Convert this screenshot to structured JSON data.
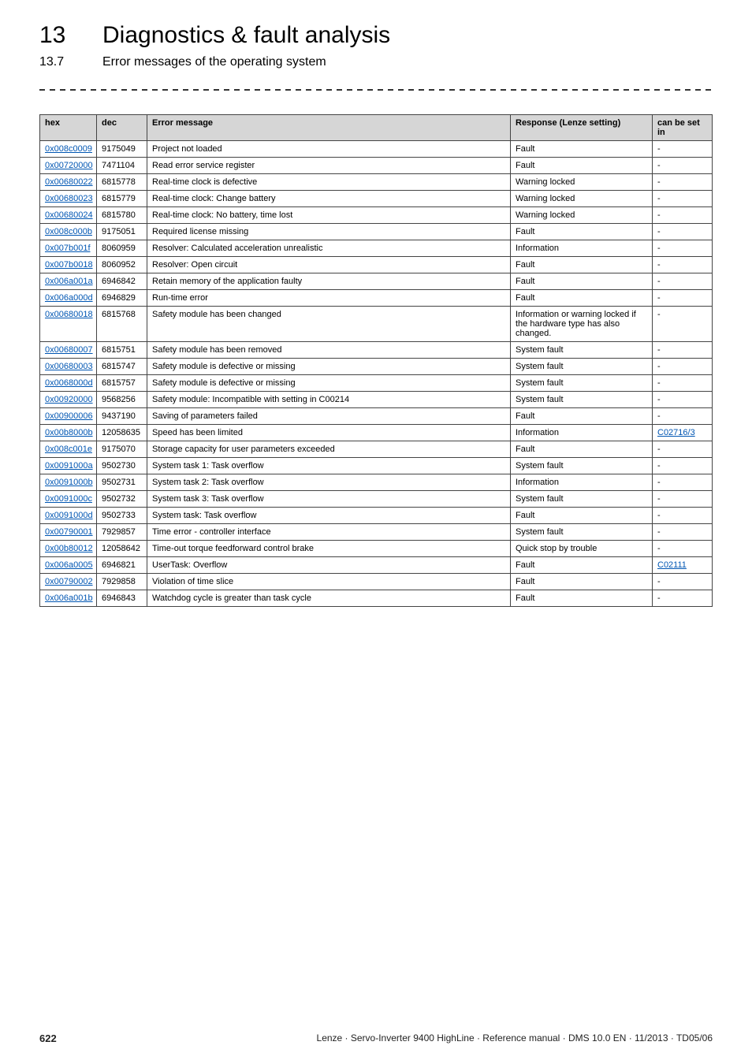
{
  "header": {
    "section_number": "13",
    "section_title": "Diagnostics & fault analysis",
    "subsection_number": "13.7",
    "subsection_title": "Error messages of the operating system"
  },
  "table": {
    "columns": {
      "hex": "hex",
      "dec": "dec",
      "msg": "Error message",
      "resp": "Response (Lenze setting)",
      "set": "can be set in"
    },
    "rows": [
      {
        "hex": "0x008c0009",
        "dec": "9175049",
        "msg": "Project not loaded",
        "resp": "Fault",
        "set": "-",
        "set_link": false
      },
      {
        "hex": "0x00720000",
        "dec": "7471104",
        "msg": "Read error service register",
        "resp": "Fault",
        "set": "-",
        "set_link": false
      },
      {
        "hex": "0x00680022",
        "dec": "6815778",
        "msg": "Real-time clock is defective",
        "resp": "Warning locked",
        "set": "-",
        "set_link": false
      },
      {
        "hex": "0x00680023",
        "dec": "6815779",
        "msg": "Real-time clock: Change battery",
        "resp": "Warning locked",
        "set": "-",
        "set_link": false
      },
      {
        "hex": "0x00680024",
        "dec": "6815780",
        "msg": "Real-time clock: No battery, time lost",
        "resp": "Warning locked",
        "set": "-",
        "set_link": false
      },
      {
        "hex": "0x008c000b",
        "dec": "9175051",
        "msg": "Required license missing",
        "resp": "Fault",
        "set": "-",
        "set_link": false
      },
      {
        "hex": "0x007b001f",
        "dec": "8060959",
        "msg": "Resolver: Calculated acceleration unrealistic",
        "resp": "Information",
        "set": "-",
        "set_link": false
      },
      {
        "hex": "0x007b0018",
        "dec": "8060952",
        "msg": "Resolver: Open circuit",
        "resp": "Fault",
        "set": "-",
        "set_link": false
      },
      {
        "hex": "0x006a001a",
        "dec": "6946842",
        "msg": "Retain memory of the application faulty",
        "resp": "Fault",
        "set": "-",
        "set_link": false
      },
      {
        "hex": "0x006a000d",
        "dec": "6946829",
        "msg": "Run-time error",
        "resp": "Fault",
        "set": "-",
        "set_link": false
      },
      {
        "hex": "0x00680018",
        "dec": "6815768",
        "msg": "Safety module has been changed",
        "resp": "Information or warning locked if the hardware type has also changed.",
        "set": "-",
        "set_link": false
      },
      {
        "hex": "0x00680007",
        "dec": "6815751",
        "msg": "Safety module has been removed",
        "resp": "System fault",
        "set": "-",
        "set_link": false
      },
      {
        "hex": "0x00680003",
        "dec": "6815747",
        "msg": "Safety module is defective or missing",
        "resp": "System fault",
        "set": "-",
        "set_link": false
      },
      {
        "hex": "0x0068000d",
        "dec": "6815757",
        "msg": "Safety module is defective or missing",
        "resp": "System fault",
        "set": "-",
        "set_link": false
      },
      {
        "hex": "0x00920000",
        "dec": "9568256",
        "msg": "Safety module: Incompatible with setting in C00214",
        "resp": "System fault",
        "set": "-",
        "set_link": false
      },
      {
        "hex": "0x00900006",
        "dec": "9437190",
        "msg": "Saving of parameters failed",
        "resp": "Fault",
        "set": "-",
        "set_link": false
      },
      {
        "hex": "0x00b8000b",
        "dec": "12058635",
        "msg": "Speed has been limited",
        "resp": "Information",
        "set": "C02716/3",
        "set_link": true
      },
      {
        "hex": "0x008c001e",
        "dec": "9175070",
        "msg": "Storage capacity for user parameters exceeded",
        "resp": "Fault",
        "set": "-",
        "set_link": false
      },
      {
        "hex": "0x0091000a",
        "dec": "9502730",
        "msg": "System task 1: Task overflow",
        "resp": "System fault",
        "set": "-",
        "set_link": false
      },
      {
        "hex": "0x0091000b",
        "dec": "9502731",
        "msg": "System task 2: Task overflow",
        "resp": "Information",
        "set": "-",
        "set_link": false
      },
      {
        "hex": "0x0091000c",
        "dec": "9502732",
        "msg": "System task 3: Task overflow",
        "resp": "System fault",
        "set": "-",
        "set_link": false
      },
      {
        "hex": "0x0091000d",
        "dec": "9502733",
        "msg": "System task: Task overflow",
        "resp": "Fault",
        "set": "-",
        "set_link": false
      },
      {
        "hex": "0x00790001",
        "dec": "7929857",
        "msg": "Time error - controller interface",
        "resp": "System fault",
        "set": "-",
        "set_link": false
      },
      {
        "hex": "0x00b80012",
        "dec": "12058642",
        "msg": "Time-out torque feedforward control brake",
        "resp": "Quick stop by trouble",
        "set": "-",
        "set_link": false
      },
      {
        "hex": "0x006a0005",
        "dec": "6946821",
        "msg": "UserTask: Overflow",
        "resp": "Fault",
        "set": "C02111",
        "set_link": true
      },
      {
        "hex": "0x00790002",
        "dec": "7929858",
        "msg": "Violation of time slice",
        "resp": "Fault",
        "set": "-",
        "set_link": false
      },
      {
        "hex": "0x006a001b",
        "dec": "6946843",
        "msg": "Watchdog cycle is greater than task cycle",
        "resp": "Fault",
        "set": "-",
        "set_link": false
      }
    ]
  },
  "footer": {
    "page": "622",
    "manual": "Lenze · Servo-Inverter 9400 HighLine · Reference manual · DMS 10.0 EN · 11/2013 · TD05/06"
  }
}
